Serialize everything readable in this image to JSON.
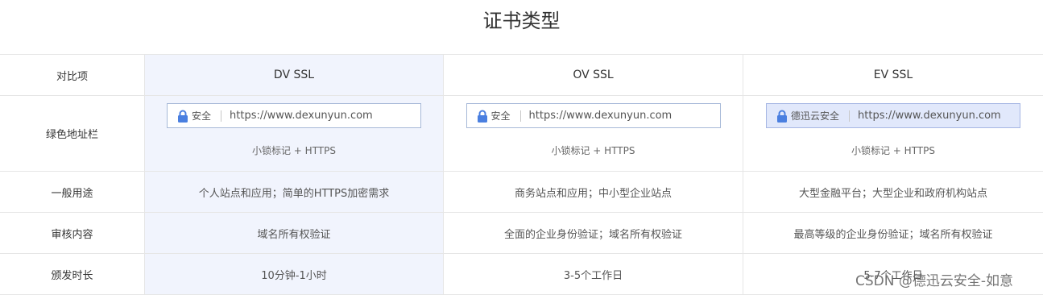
{
  "title": "证书类型",
  "header": {
    "label": "对比项",
    "dv": "DV SSL",
    "ov": "OV SSL",
    "ev": "EV SSL"
  },
  "rows": {
    "address_bar": {
      "label": "绿色地址栏",
      "dv": {
        "secure": "安全",
        "url": "https://www.dexunyun.com",
        "note": "小锁标记 + HTTPS"
      },
      "ov": {
        "secure": "安全",
        "url": "https://www.dexunyun.com",
        "note": "小锁标记 + HTTPS"
      },
      "ev": {
        "secure": "德迅云安全",
        "url": "https://www.dexunyun.com",
        "note": "小锁标记 + HTTPS"
      }
    },
    "usage": {
      "label": "一般用途",
      "dv": "个人站点和应用；简单的HTTPS加密需求",
      "ov": "商务站点和应用；中小型企业站点",
      "ev": "大型金融平台；大型企业和政府机构站点"
    },
    "review": {
      "label": "审核内容",
      "dv": "域名所有权验证",
      "ov": "全面的企业身份验证；域名所有权验证",
      "ev": "最高等级的企业身份验证；域名所有权验证"
    },
    "issue_time": {
      "label": "颁发时长",
      "dv": "10分钟-1小时",
      "ov": "3-5个工作日",
      "ev": "5-7个工作日"
    }
  },
  "watermark": "CSDN @德迅云安全-如意",
  "colors": {
    "dv_column_bg": "#f1f4fd",
    "ev_bar_bg": "#e1e8fb",
    "lock_icon": "#4a7fe0",
    "border": "#e6e6e6"
  }
}
